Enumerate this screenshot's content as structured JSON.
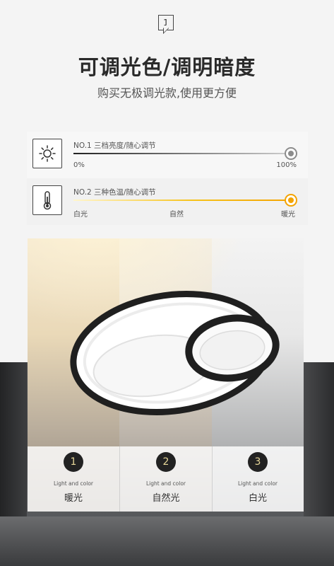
{
  "page": {
    "badge": "1",
    "title": "可调光色/调明暗度",
    "subtitle": "购买无极调光款,使用更方便"
  },
  "controls": [
    {
      "icon": "sun-icon",
      "label": "NO.1 三档亮度/随心调节",
      "scale_left": "0%",
      "scale_right": "100%",
      "level": 1.0
    },
    {
      "icon": "thermometer-icon",
      "label": "NO.2 三种色温/随心调节",
      "scale_left": "白光",
      "scale_mid": "自然",
      "scale_right": "暖光",
      "level": 1.0
    }
  ],
  "modes": [
    {
      "num": "1",
      "en": "Light and color",
      "zh": "暖光"
    },
    {
      "num": "2",
      "en": "Light and color",
      "zh": "自然光"
    },
    {
      "num": "3",
      "en": "Light and color",
      "zh": "白光"
    }
  ],
  "colors": {
    "warm_accent": "#f3a300",
    "dark": "#222222",
    "number_text": "#e8d89a"
  }
}
